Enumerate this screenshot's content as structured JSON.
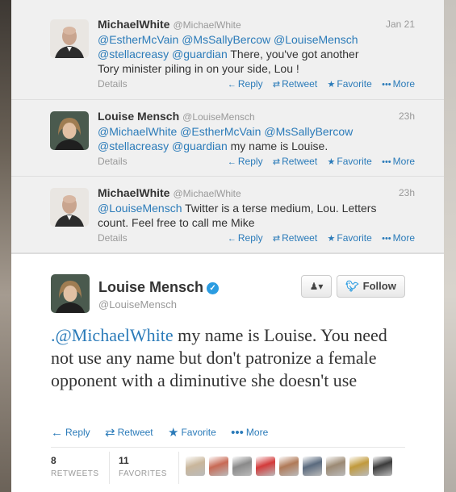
{
  "conversation": [
    {
      "name": "MichaelWhite",
      "handle": "@MichaelWhite",
      "time": "Jan 21",
      "avatar_icon": "bald-man-avatar",
      "text_parts": [
        {
          "text": "@EstherMcVain",
          "mention": true
        },
        {
          "text": " ",
          "mention": false
        },
        {
          "text": "@MsSallyBercow",
          "mention": true
        },
        {
          "text": " ",
          "mention": false
        },
        {
          "text": "@LouiseMensch",
          "mention": true
        },
        {
          "text": " ",
          "mention": false
        },
        {
          "text": "@stellacreasy",
          "mention": true
        },
        {
          "text": " ",
          "mention": false
        },
        {
          "text": "@guardian",
          "mention": true
        },
        {
          "text": " There, you've got another Tory minister piling in on your side, Lou !",
          "mention": false
        }
      ]
    },
    {
      "name": "Louise Mensch",
      "handle": "@LouiseMensch",
      "time": "23h",
      "avatar_icon": "woman-avatar",
      "text_parts": [
        {
          "text": "@MichaelWhite",
          "mention": true
        },
        {
          "text": " ",
          "mention": false
        },
        {
          "text": "@EstherMcVain",
          "mention": true
        },
        {
          "text": " ",
          "mention": false
        },
        {
          "text": "@MsSallyBercow",
          "mention": true
        },
        {
          "text": " ",
          "mention": false
        },
        {
          "text": "@stellacreasy",
          "mention": true
        },
        {
          "text": " ",
          "mention": false
        },
        {
          "text": "@guardian",
          "mention": true
        },
        {
          "text": " my name is Louise.",
          "mention": false
        }
      ]
    },
    {
      "name": "MichaelWhite",
      "handle": "@MichaelWhite",
      "time": "23h",
      "avatar_icon": "bald-man-avatar",
      "text_parts": [
        {
          "text": "@LouiseMensch",
          "mention": true
        },
        {
          "text": " Twitter is a terse medium, Lou. Letters count. Feel free to call me Mike",
          "mention": false
        }
      ]
    }
  ],
  "tweet_actions": {
    "details": "Details",
    "reply": "Reply",
    "retweet": "Retweet",
    "favorite": "Favorite",
    "more": "More"
  },
  "main": {
    "name": "Louise Mensch",
    "handle": "@LouiseMensch",
    "verified": true,
    "follow_label": "Follow",
    "text_mention": ".@MichaelWhite",
    "text_rest": " my name is Louise. You need not use any name but don't patronize a female opponent with a diminutive she doesn't use",
    "actions": {
      "reply": "Reply",
      "retweet": "Retweet",
      "favorite": "Favorite",
      "more": "More"
    },
    "stats": {
      "retweets_count": "8",
      "retweets_label": "RETWEETS",
      "favorites_count": "11",
      "favorites_label": "FAVORITES"
    },
    "favoriters": [
      {
        "name": "favoriter-avatar-1",
        "color": "#c9b69b"
      },
      {
        "name": "favoriter-avatar-2",
        "color": "#c86a55"
      },
      {
        "name": "favoriter-avatar-3",
        "color": "#8a8a8a"
      },
      {
        "name": "favoriter-avatar-4",
        "color": "#d33b3b"
      },
      {
        "name": "favoriter-avatar-5",
        "color": "#b07a58"
      },
      {
        "name": "favoriter-avatar-6",
        "color": "#5a6a7e"
      },
      {
        "name": "favoriter-avatar-7",
        "color": "#9c8a74"
      },
      {
        "name": "favoriter-avatar-8",
        "color": "#c19a3c"
      },
      {
        "name": "favoriter-avatar-9",
        "color": "#3b3b3b"
      }
    ]
  },
  "colors": {
    "link": "#2b7bb9",
    "verified": "#2b9ce1",
    "muted": "#999999"
  }
}
